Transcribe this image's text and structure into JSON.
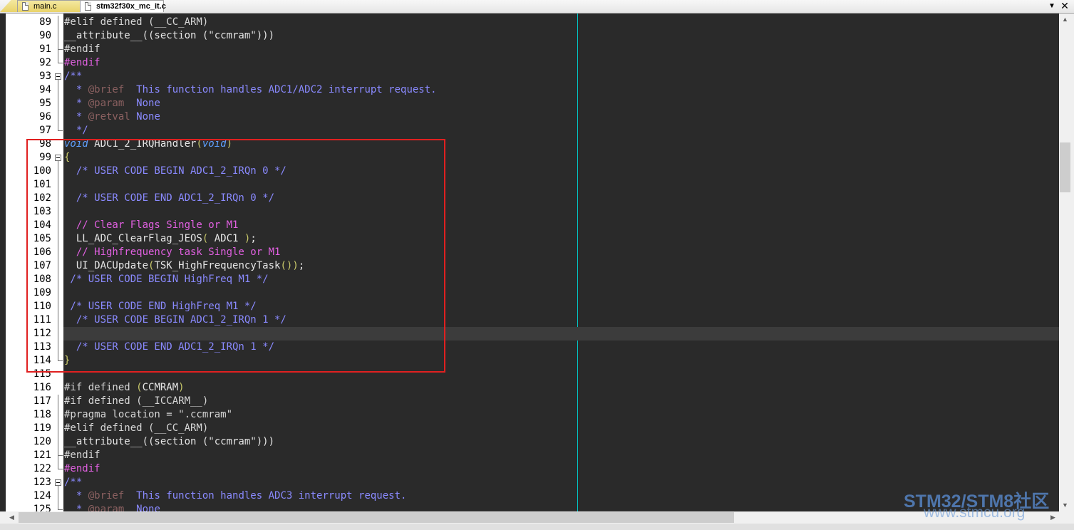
{
  "tabs": [
    {
      "label": "main.c",
      "active": false
    },
    {
      "label": "stm32f30x_mc_it.c",
      "active": true
    }
  ],
  "tab_controls": {
    "dropdown": "▼",
    "close": "✕"
  },
  "lines": [
    {
      "n": "89",
      "segments": [
        {
          "c": "pp",
          "t": "#elif defined (__CC_ARM)"
        }
      ]
    },
    {
      "n": "90",
      "segments": [
        {
          "c": "tx",
          "t": "__attribute__((section (\"ccmram\")))"
        }
      ]
    },
    {
      "n": "91",
      "segments": [
        {
          "c": "pp",
          "t": "#endif"
        }
      ]
    },
    {
      "n": "92",
      "segments": [
        {
          "c": "pk",
          "t": "#endif"
        }
      ]
    },
    {
      "n": "93",
      "segments": [
        {
          "c": "cm",
          "t": "/**"
        }
      ]
    },
    {
      "n": "94",
      "segments": [
        {
          "c": "cm",
          "t": "  * "
        },
        {
          "c": "ct",
          "t": "@brief"
        },
        {
          "c": "cm",
          "t": "  This function handles ADC1/ADC2 interrupt request."
        }
      ]
    },
    {
      "n": "95",
      "segments": [
        {
          "c": "cm",
          "t": "  * "
        },
        {
          "c": "ct",
          "t": "@param"
        },
        {
          "c": "cm",
          "t": "  None"
        }
      ]
    },
    {
      "n": "96",
      "segments": [
        {
          "c": "cm",
          "t": "  * "
        },
        {
          "c": "ct",
          "t": "@retval"
        },
        {
          "c": "cm",
          "t": " None"
        }
      ]
    },
    {
      "n": "97",
      "segments": [
        {
          "c": "cm",
          "t": "  */"
        }
      ]
    },
    {
      "n": "98",
      "segments": [
        {
          "c": "kw",
          "t": "void"
        },
        {
          "c": "tx",
          "t": " ADC1_2_IRQHandler"
        },
        {
          "c": "br",
          "t": "("
        },
        {
          "c": "kw",
          "t": "void"
        },
        {
          "c": "br",
          "t": ")"
        }
      ]
    },
    {
      "n": "99",
      "segments": [
        {
          "c": "br",
          "t": "{"
        }
      ]
    },
    {
      "n": "100",
      "segments": [
        {
          "c": "cm",
          "t": "  /* USER CODE BEGIN ADC1_2_IRQn 0 */"
        }
      ]
    },
    {
      "n": "101",
      "segments": []
    },
    {
      "n": "102",
      "segments": [
        {
          "c": "cm",
          "t": "  /* USER CODE END ADC1_2_IRQn 0 */"
        }
      ]
    },
    {
      "n": "103",
      "segments": []
    },
    {
      "n": "104",
      "segments": [
        {
          "c": "pk",
          "t": "  // Clear Flags Single or M1"
        }
      ]
    },
    {
      "n": "105",
      "segments": [
        {
          "c": "tx",
          "t": "  LL_ADC_ClearFlag_JEOS"
        },
        {
          "c": "br",
          "t": "("
        },
        {
          "c": "tx",
          "t": " ADC1 "
        },
        {
          "c": "br",
          "t": ")"
        },
        {
          "c": "tx",
          "t": ";"
        }
      ]
    },
    {
      "n": "106",
      "segments": [
        {
          "c": "pk",
          "t": "  // Highfrequency task Single or M1"
        }
      ]
    },
    {
      "n": "107",
      "segments": [
        {
          "c": "tx",
          "t": "  UI_DACUpdate"
        },
        {
          "c": "br",
          "t": "("
        },
        {
          "c": "tx",
          "t": "TSK_HighFrequencyTask"
        },
        {
          "c": "br",
          "t": "())"
        },
        {
          "c": "tx",
          "t": ";"
        }
      ]
    },
    {
      "n": "108",
      "segments": [
        {
          "c": "cm",
          "t": " /* USER CODE BEGIN HighFreq M1 */"
        }
      ]
    },
    {
      "n": "109",
      "segments": []
    },
    {
      "n": "110",
      "segments": [
        {
          "c": "cm",
          "t": " /* USER CODE END HighFreq M1 */"
        }
      ]
    },
    {
      "n": "111",
      "segments": [
        {
          "c": "cm",
          "t": "  /* USER CODE BEGIN ADC1_2_IRQn 1 */"
        }
      ]
    },
    {
      "n": "112",
      "segments": []
    },
    {
      "n": "113",
      "segments": [
        {
          "c": "cm",
          "t": "  /* USER CODE END ADC1_2_IRQn 1 */"
        }
      ]
    },
    {
      "n": "114",
      "segments": [
        {
          "c": "br",
          "t": "}"
        }
      ]
    },
    {
      "n": "115",
      "segments": []
    },
    {
      "n": "116",
      "segments": [
        {
          "c": "pp",
          "t": "#if defined "
        },
        {
          "c": "br",
          "t": "("
        },
        {
          "c": "tx",
          "t": "CCMRAM"
        },
        {
          "c": "br",
          "t": ")"
        }
      ]
    },
    {
      "n": "117",
      "segments": [
        {
          "c": "pp",
          "t": "#if defined (__ICCARM__)"
        }
      ]
    },
    {
      "n": "118",
      "segments": [
        {
          "c": "pp",
          "t": "#pragma location = \".ccmram\""
        }
      ]
    },
    {
      "n": "119",
      "segments": [
        {
          "c": "pp",
          "t": "#elif defined (__CC_ARM)"
        }
      ]
    },
    {
      "n": "120",
      "segments": [
        {
          "c": "tx",
          "t": "__attribute__((section (\"ccmram\")))"
        }
      ]
    },
    {
      "n": "121",
      "segments": [
        {
          "c": "pp",
          "t": "#endif"
        }
      ]
    },
    {
      "n": "122",
      "segments": [
        {
          "c": "pk",
          "t": "#endif"
        }
      ]
    },
    {
      "n": "123",
      "segments": [
        {
          "c": "cm",
          "t": "/**"
        }
      ]
    },
    {
      "n": "124",
      "segments": [
        {
          "c": "cm",
          "t": "  * "
        },
        {
          "c": "ct",
          "t": "@brief"
        },
        {
          "c": "cm",
          "t": "  This function handles ADC3 interrupt request."
        }
      ]
    },
    {
      "n": "125",
      "segments": [
        {
          "c": "cm",
          "t": "  * "
        },
        {
          "c": "ct",
          "t": "@param"
        },
        {
          "c": "cm",
          "t": "  None"
        }
      ]
    }
  ],
  "current_line": "112",
  "watermark": {
    "title": "STM32/STM8社区",
    "url": "www.stmcu.org"
  },
  "colors": {
    "editor_bg": "#2a2a2a",
    "comment": "#8a8aff",
    "keyword": "#5fa0ff",
    "preprocessor_pink": "#e060e0",
    "highlight_box": "#e02020",
    "edge_line": "#00c8c8"
  }
}
